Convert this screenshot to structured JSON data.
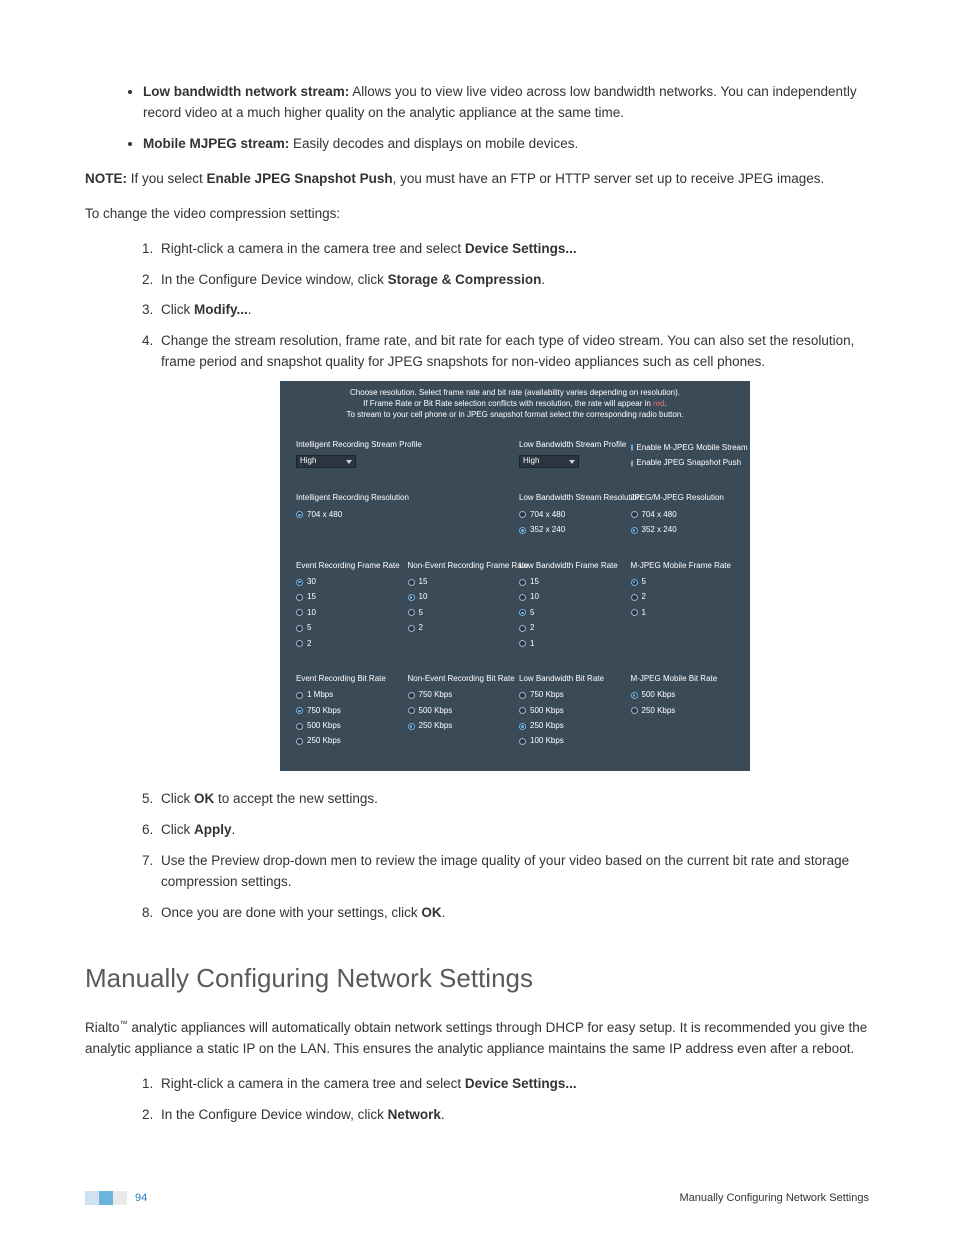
{
  "bullets": [
    {
      "bold": "Low bandwidth network stream:",
      "rest": " Allows you to view live video across low bandwidth networks. You can independently record video at a much higher quality on the analytic appliance at the same time."
    },
    {
      "bold": "Mobile MJPEG stream:",
      "rest": " Easily decodes and displays on mobile devices."
    }
  ],
  "note": {
    "prefix": "NOTE:",
    "mid1": " If you select ",
    "bold2": "Enable JPEG Snapshot Push",
    "rest": ", you must have an FTP or HTTP server set up to receive JPEG images."
  },
  "intro_change": "To change the video compression settings:",
  "steps_a": {
    "s1a": "Right-click a camera in the camera tree and select ",
    "s1b": "Device Settings...",
    "s2a": "In the Configure Device window, click ",
    "s2b": "Storage & Compression",
    "s2c": ".",
    "s3a": "Click ",
    "s3b": "Modify...",
    "s3c": ".",
    "s4": "Change the stream resolution, frame rate, and bit rate for each type of video stream. You can also set the resolution, frame period and snapshot quality for JPEG snapshots for non-video appliances such as cell phones."
  },
  "panel": {
    "hdr_l1": "Choose resolution. Select frame rate and bit rate (availability varies depending on resolution).",
    "hdr_l2a": "If Frame Rate or Bit Rate selection conflicts with resolution, the rate will appear in ",
    "hdr_l2_red": "red",
    "hdr_l2b": ".",
    "hdr_l3": "To stream to your cell phone or in JPEG snapshot format select the corresponding radio button.",
    "sel_high": "High",
    "labels": {
      "irsp": "Intelligent Recording Stream Profile",
      "lbsp": "Low Bandwidth Stream Profile",
      "en_mjpeg": "Enable M-JPEG Mobile Stream",
      "en_snap": "Enable JPEG Snapshot Push",
      "irr": "Intelligent Recording Resolution",
      "lbsr": "Low Bandwidth Stream Resolution",
      "jmr": "JPEG/M-JPEG Resolution",
      "erfr": "Event Recording Frame Rate",
      "nerfr": "Non-Event Recording Frame Rate",
      "lbfr": "Low Bandwidth Frame Rate",
      "mjfr": "M-JPEG Mobile Frame Rate",
      "erbr": "Event Recording Bit Rate",
      "nerbr": "Non-Event Recording Bit Rate",
      "lbbr": "Low Bandwidth Bit Rate",
      "mjbr": "M-JPEG Mobile Bit Rate"
    },
    "res": {
      "r704": "704 x 480",
      "r352": "352 x 240"
    },
    "fr": {
      "f30": "30",
      "f15": "15",
      "f10": "10",
      "f5": "5",
      "f2": "2",
      "f1": "1"
    },
    "br": {
      "b1m": "1 Mbps",
      "b750": "750 Kbps",
      "b500": "500 Kbps",
      "b250": "250 Kbps",
      "b100": "100 Kbps"
    }
  },
  "steps_b": {
    "s5a": "Click ",
    "s5b": "OK",
    "s5c": " to accept the new settings.",
    "s6a": "Click ",
    "s6b": "Apply",
    "s6c": ".",
    "s7": "Use the Preview drop-down men to review the image quality of your video based on the current bit rate and storage compression settings.",
    "s8a": "Once you are done with your settings, click ",
    "s8b": "OK",
    "s8c": "."
  },
  "section2": {
    "title": "Manually Configuring Network Settings",
    "p_a": "Rialto",
    "p_b": " analytic appliances will automatically obtain network settings through DHCP for easy setup. It is recommended you give the analytic appliance a static IP on the LAN. This ensures the analytic appliance maintains the same IP address even after a reboot.",
    "s1a": "Right-click a camera in the camera tree and select ",
    "s1b": "Device Settings...",
    "s2a": "In the Configure Device window, click ",
    "s2b": "Network",
    "s2c": "."
  },
  "footer": {
    "page": "94",
    "title": "Manually Configuring Network Settings"
  }
}
